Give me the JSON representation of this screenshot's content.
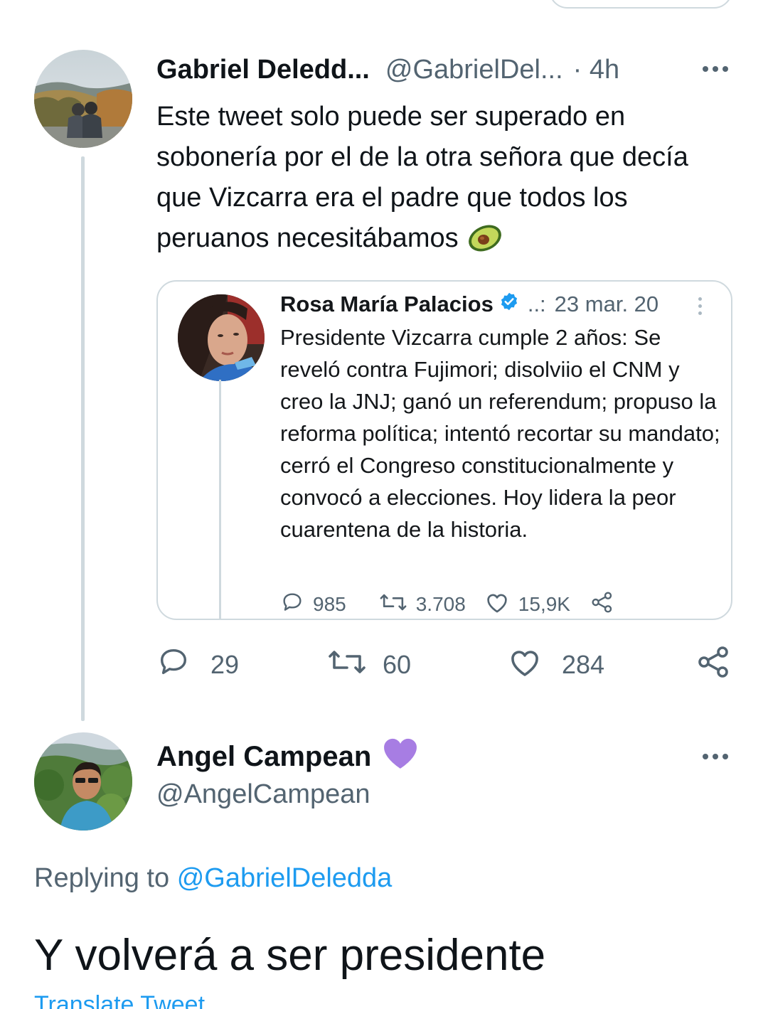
{
  "parent_tweet": {
    "author_name": "Gabriel Deledd...",
    "author_handle": "@GabrielDel...",
    "time": "· 4h",
    "text": "Este tweet solo puede ser superado en sobonería por el de la otra señora que decía que Vizcarra era el padre que todos los peruanos necesitábamos",
    "emoji_icon": "avocado-icon",
    "quoted_tweet": {
      "author_name": "Rosa María Palacios",
      "verified_icon": "verified-badge-icon",
      "dots": "..:",
      "date": "23 mar. 20",
      "text": "Presidente Vizcarra cumple 2 años: Se reveló contra Fujimori; disolviio el CNM y creo la JNJ; ganó un referendum; propuso la reforma política; intentó recortar su mandato; cerró el Congreso constitucionalmente y convocó a elecciones. Hoy lidera la peor cuarentena de la historia.",
      "replies": "985",
      "retweets": "3.708",
      "likes": "15,9K"
    },
    "actions": {
      "replies": "29",
      "retweets": "60",
      "likes": "284"
    }
  },
  "reply_tweet": {
    "author_name": "Angel Campean",
    "name_emoji_icon": "purple-heart-icon",
    "author_handle": "@AngelCampean",
    "replying_label": "Replying to",
    "replying_mention": "@GabrielDeledda",
    "text": "Y volverá a ser presidente",
    "translate_label": "Translate Tweet"
  },
  "colors": {
    "text_primary": "#0f1419",
    "text_secondary": "#536471",
    "link": "#1d9bf0",
    "border": "#cfd9de",
    "purple_heart": "#a77de3"
  }
}
